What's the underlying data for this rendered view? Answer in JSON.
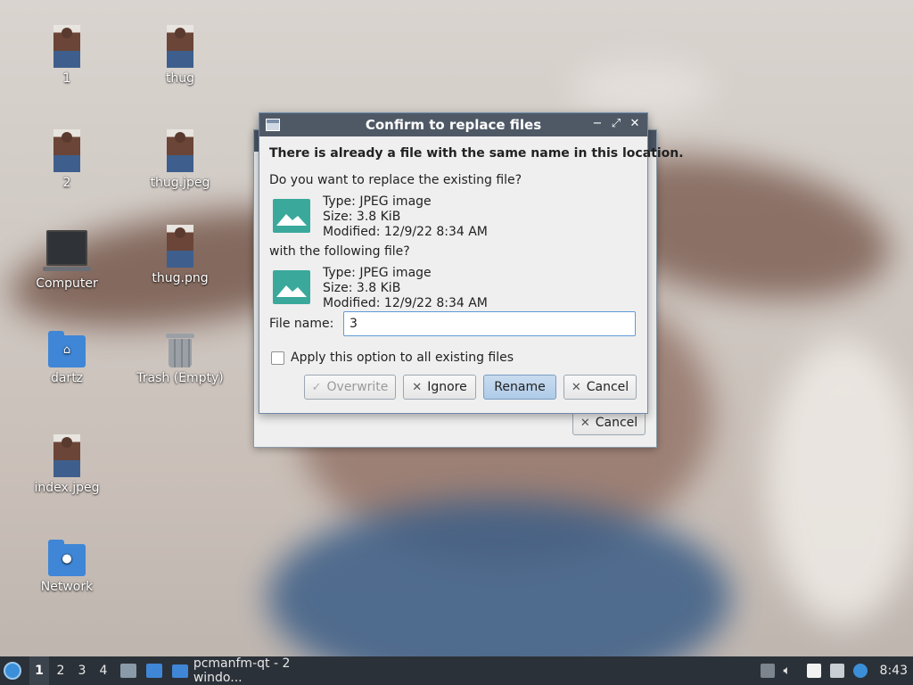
{
  "desktop": {
    "icons": [
      {
        "label": "1",
        "kind": "image-thumbnail"
      },
      {
        "label": "thug",
        "kind": "image-thumbnail"
      },
      {
        "label": "2",
        "kind": "image-thumbnail"
      },
      {
        "label": "thug.jpeg",
        "kind": "image-thumbnail"
      },
      {
        "label": "Computer",
        "kind": "computer-icon"
      },
      {
        "label": "thug.png",
        "kind": "image-thumbnail"
      },
      {
        "label": "dartz",
        "kind": "home-folder-icon"
      },
      {
        "label": "Trash (Empty)",
        "kind": "trash-icon"
      },
      {
        "label": "index.jpeg",
        "kind": "image-thumbnail"
      },
      {
        "label": "Network",
        "kind": "network-folder-icon"
      }
    ]
  },
  "back_dialog": {
    "cancel_label": "Cancel"
  },
  "dialog": {
    "title": "Confirm to replace files",
    "heading": "There is already a file with the same name in this location.",
    "question_existing": "Do you want to replace the existing file?",
    "existing_file": {
      "type": "Type: JPEG image",
      "size": "Size: 3.8 KiB",
      "modified": "Modified: 12/9/22 8:34 AM"
    },
    "question_new": "with the following file?",
    "new_file": {
      "type": "Type: JPEG image",
      "size": "Size: 3.8 KiB",
      "modified": "Modified: 12/9/22 8:34 AM"
    },
    "file_name_label": "File name:",
    "file_name_value": "3",
    "apply_all_label": "Apply this option to all existing files",
    "apply_all_checked": false,
    "buttons": {
      "overwrite": "Overwrite",
      "ignore": "Ignore",
      "rename": "Rename",
      "cancel": "Cancel"
    }
  },
  "taskbar": {
    "workspaces": [
      "1",
      "2",
      "3",
      "4"
    ],
    "active_workspace": "1",
    "task_label": "pcmanfm-qt - 2 windo...",
    "clock": "8:43"
  },
  "colors": {
    "titlebar": "#4f5966",
    "taskbar": "#2b3138",
    "folder": "#3f86d6",
    "file_thumb": "#3aa99c",
    "primary_button": "#aecbe8"
  }
}
